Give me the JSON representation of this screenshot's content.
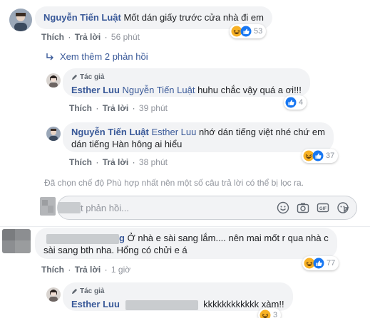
{
  "comment1": {
    "author": "Nguyễn Tiến Luật",
    "text": "Mốt dán giấy trước cửa nhà đi em",
    "like": "Thích",
    "reply": "Trả lời",
    "time": "56 phút",
    "reaction_count": "53"
  },
  "more_replies": "Xem thêm 2 phản hồi",
  "reply1": {
    "author_tag": "Tác giả",
    "author": "Esther Luu",
    "mention": "Nguyễn Tiến Luật",
    "text": "huhu chắc vậy quá a ơi!!!",
    "like": "Thích",
    "reply": "Trả lời",
    "time": "39 phút",
    "reaction_count": "4"
  },
  "reply2": {
    "author": "Nguyễn Tiến Luật",
    "mention": "Esther Luu",
    "text_line1": "nhớ dán tiếng việt nhé chứ em",
    "text_line2": "dán tiếng Hàn hông ai hiểu",
    "like": "Thích",
    "reply": "Trả lời",
    "time": "38 phút",
    "reaction_count": "37"
  },
  "filter_notice": "Đã chọn chế độ Phù hợp nhất nên một số câu trả lời có thể bị lọc ra.",
  "composer": {
    "placeholder": "t phản hồi..."
  },
  "comment2": {
    "author_suffix": "g",
    "text_line1": "Ở nhà e sài sang lắm.... nên mai mốt r qua nhà c",
    "text_line2": "sài sang bth nha. Hổng có chửi e á",
    "like": "Thích",
    "reply": "Trả lời",
    "time": "1 giờ",
    "reaction_count": "77"
  },
  "reply3": {
    "author_tag": "Tác giả",
    "author": "Esther Luu",
    "text": "kkkkkkkkkkkk xàm!!",
    "reaction_count": "3"
  },
  "colors": {
    "name": "#385898",
    "bubble": "#f2f3f5",
    "like_blue": "#1877f2",
    "haha_yellow": "#f7b125"
  }
}
